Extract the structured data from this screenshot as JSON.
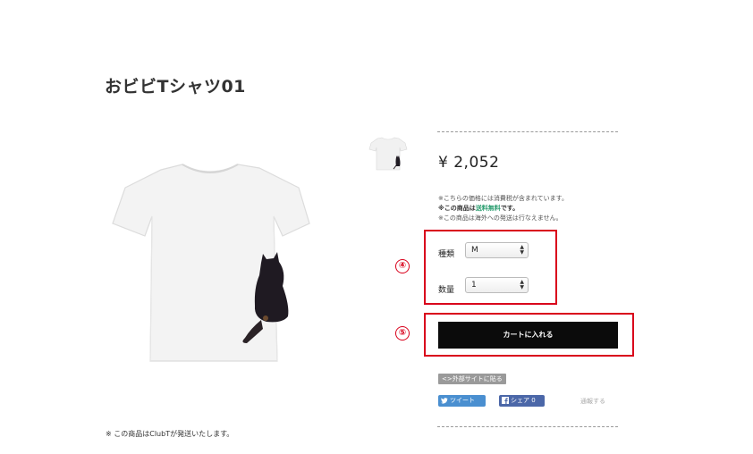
{
  "product": {
    "title": "おビビTシャツ01",
    "price": "¥ 2,052",
    "notes": {
      "tax": "※こちらの価格には消費税が含まれています。",
      "shipping_prefix": "※この商品は",
      "shipping_free": "送料無料",
      "shipping_suffix": "です。",
      "overseas": "※この商品は海外への発送は行なえません。"
    },
    "bottom_note": "※ この商品はClubTが発送いたします。"
  },
  "options": {
    "type_label": "種類",
    "type_value": "M",
    "qty_label": "数量",
    "qty_value": "1"
  },
  "annotations": {
    "badge_4": "④",
    "badge_5": "⑤",
    "color": "#d9001b"
  },
  "actions": {
    "cart_label": "カートに入れる",
    "embed_label": "外部サイトに貼る",
    "tweet_label": "ツイート",
    "share_label": "シェア 0",
    "report_label": "通報する"
  },
  "icons": {
    "embed": "code-icon",
    "tweet": "twitter-bird-icon",
    "share": "facebook-icon",
    "select": "updown-arrows-icon"
  }
}
